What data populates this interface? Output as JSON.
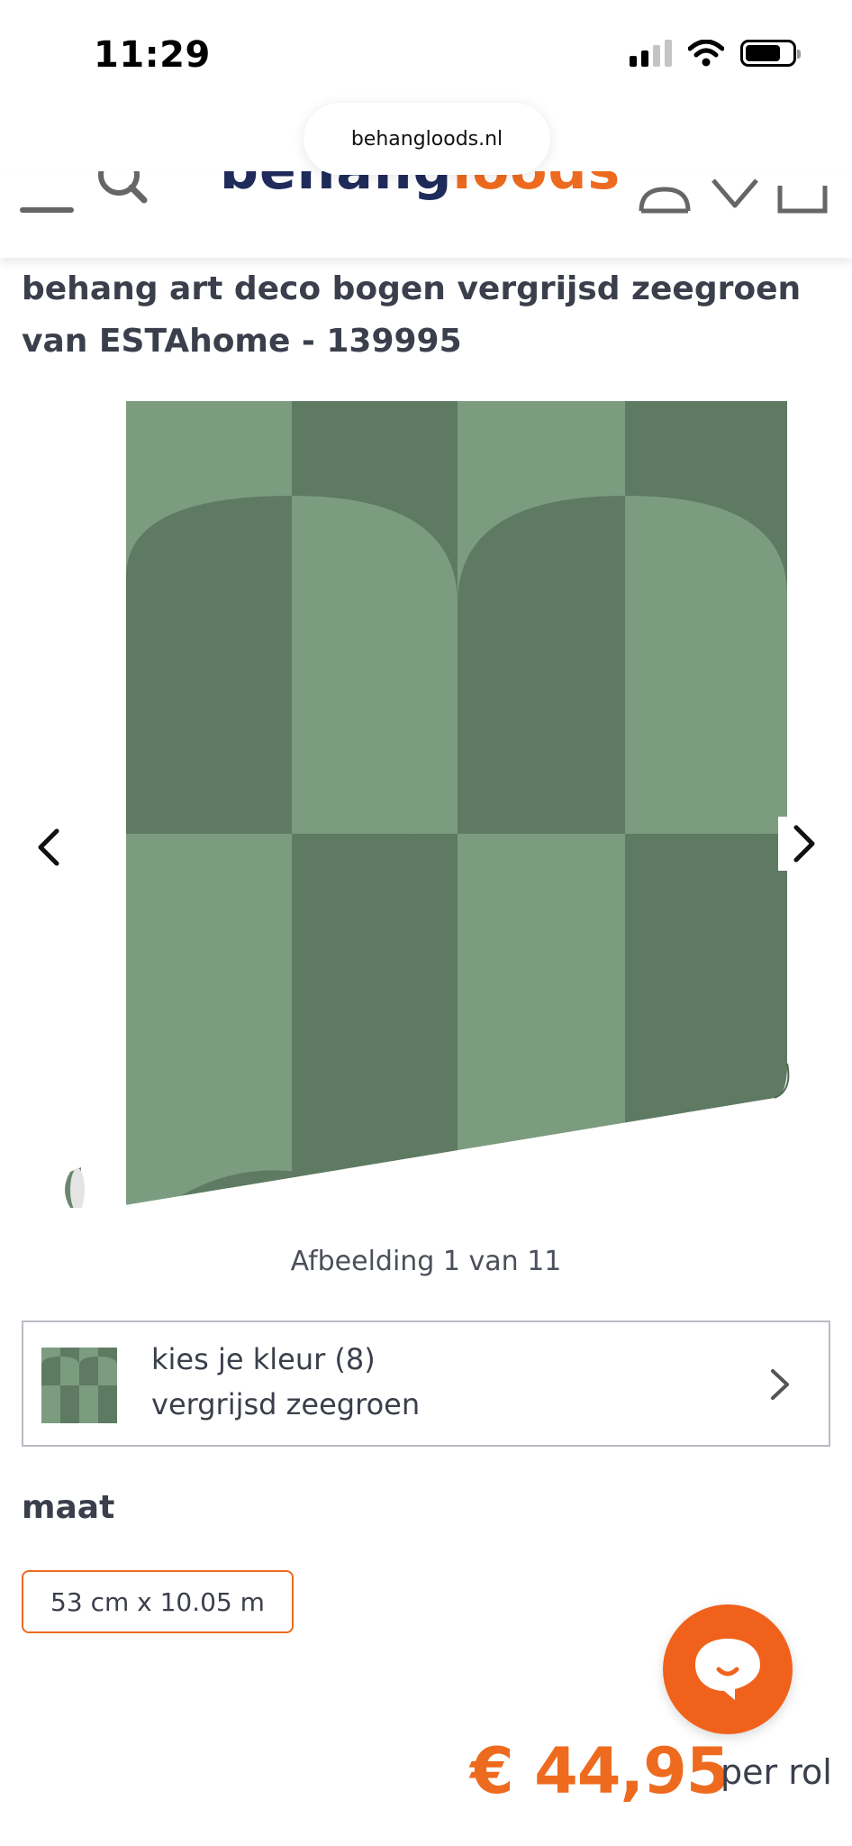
{
  "status_bar": {
    "time": "11:29",
    "icons": [
      "cellular-signal-icon",
      "wifi-icon",
      "battery-icon"
    ]
  },
  "browser": {
    "url": "behangloods.nl"
  },
  "header": {
    "logo_part1": "behang",
    "logo_part2": "loods",
    "icons": [
      "menu-icon",
      "search-icon",
      "account-icon",
      "heart-icon",
      "cart-icon"
    ]
  },
  "product": {
    "title": "behang art deco bogen vergrijsd zeegroen van ESTAhome - 139995",
    "gallery": {
      "counter_text": "Afbeelding 1 van 11",
      "current_image": 1,
      "total_images": 11
    },
    "color_selector": {
      "label": "kies je kleur (8)",
      "value": "vergrijsd zeegroen"
    },
    "size": {
      "heading": "maat",
      "selected_option": "53 cm x 10.05 m"
    },
    "price": "€ 44,95",
    "price_unit": "per rol"
  },
  "colors": {
    "brand_orange": "#ee6a1e",
    "brand_navy": "#1f2b5a",
    "wallpaper_light_green": "#7c9c80",
    "wallpaper_dark_green": "#5f7a62"
  }
}
